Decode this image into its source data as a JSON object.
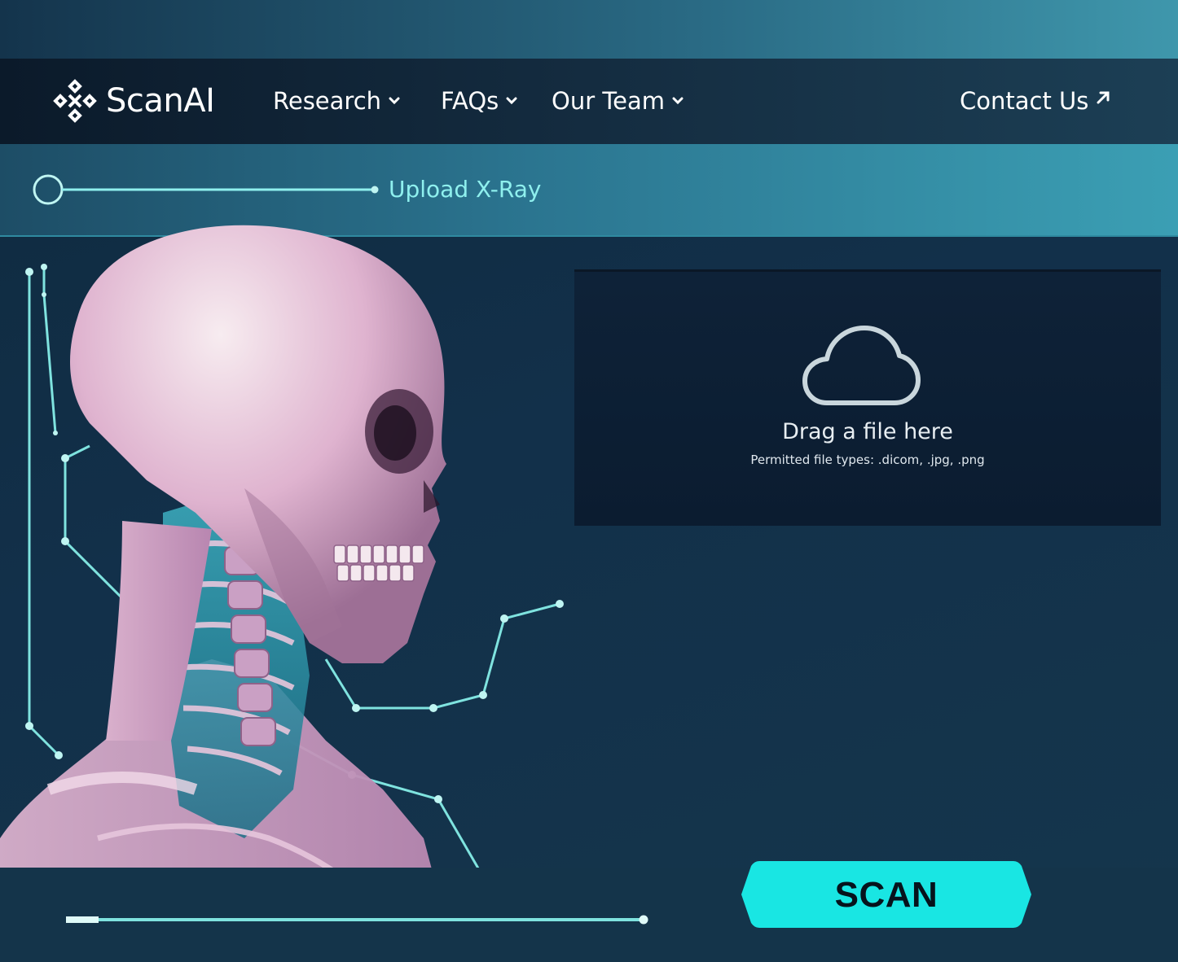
{
  "brand": {
    "name": "ScanAI",
    "logo_icon": "diamond-cross-icon"
  },
  "nav": {
    "items": [
      {
        "label": "Research",
        "icon": "chevron-down-icon"
      },
      {
        "label": "FAQs",
        "icon": "chevron-down-icon"
      },
      {
        "label": "Our Team",
        "icon": "chevron-down-icon"
      }
    ],
    "contact": {
      "label": "Contact Us",
      "icon": "arrow-up-right-icon"
    }
  },
  "upload_step": {
    "label": "Upload X-Ray"
  },
  "drop_zone": {
    "icon": "cloud-icon",
    "title": "Drag a file here",
    "subtitle": "Permitted file types: .dicom, .jpg, .png"
  },
  "scan_button": {
    "label": "SCAN"
  },
  "colors": {
    "accent": "#19e6e3",
    "line": "#7fe3df",
    "navbar": "#0b1a2a",
    "drop_zone_bg": "#0d2036",
    "bone": "#e8c9dc"
  }
}
